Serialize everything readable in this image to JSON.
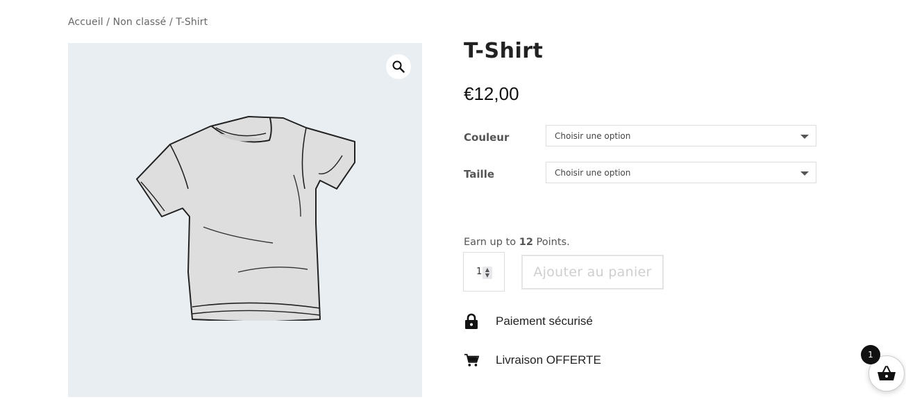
{
  "breadcrumb": {
    "items": [
      "Accueil",
      "Non classé",
      "T-Shirt"
    ],
    "separator": "/"
  },
  "product": {
    "title": "T-Shirt",
    "price": "€12,00",
    "image_bg_color": "#e9eef2"
  },
  "variations": [
    {
      "label": "Couleur",
      "selected": "Choisir une option"
    },
    {
      "label": "Taille",
      "selected": "Choisir une option"
    }
  ],
  "points": {
    "prefix": "Earn up to",
    "amount": "12",
    "suffix": "Points."
  },
  "cart_form": {
    "quantity": "1",
    "add_button_label": "Ajouter au panier"
  },
  "features": [
    {
      "icon": "lock-icon",
      "text": "Paiement sécurisé"
    },
    {
      "icon": "cart-icon",
      "text": "Livraison OFFERTE"
    }
  ],
  "floating_cart": {
    "icon": "basket-icon",
    "count": "1"
  }
}
